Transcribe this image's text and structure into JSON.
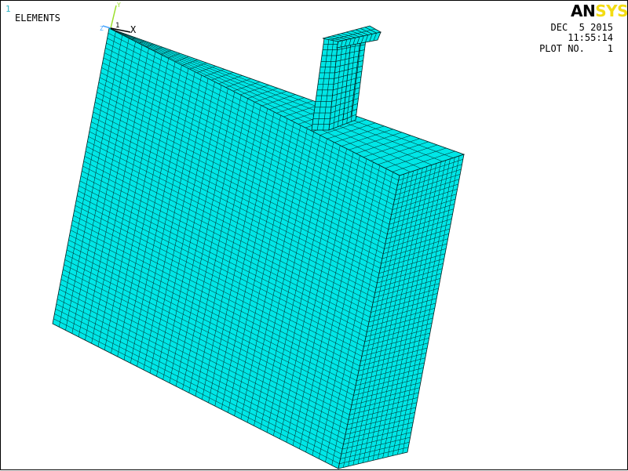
{
  "window": {
    "number": "1",
    "plot_type_label": "ELEMENTS",
    "logo_primary": "AN",
    "logo_accent": "SYS",
    "date": "DEC  5 2015",
    "time": "11:55:14",
    "plot_number": "PLOT NO.    1"
  },
  "triad": {
    "x_axis_label": "X",
    "y_axis_label": "Y",
    "z_axis_label": "Z",
    "origin_label": "1"
  },
  "colors": {
    "element_fill": "#00e6e6",
    "mesh_line": "#002020",
    "logo_accent": "#f3dc12",
    "window_number": "#2fb3c4",
    "triad_y": "#9adf2a",
    "triad_z": "#4aa6ff"
  }
}
